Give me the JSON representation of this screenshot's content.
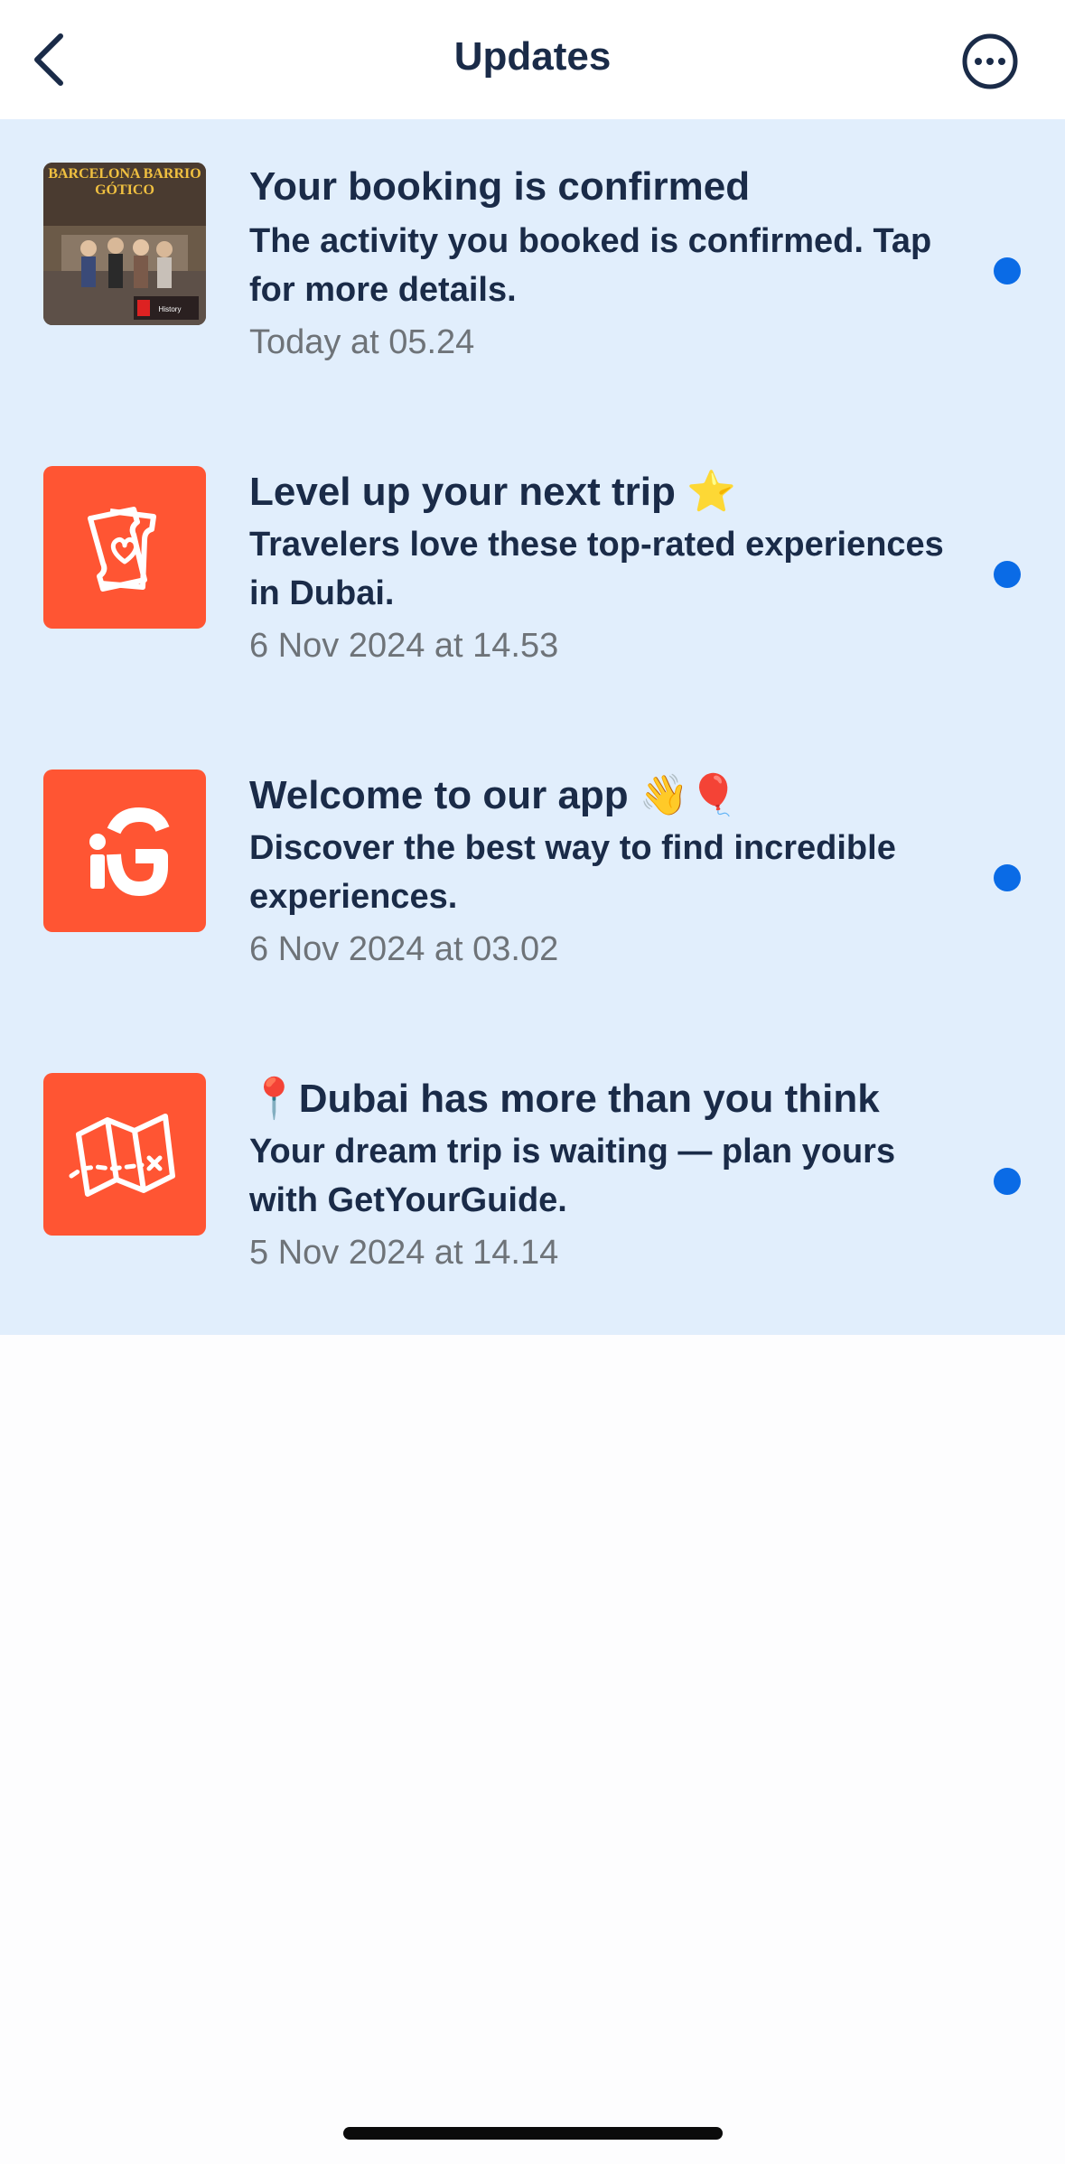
{
  "header": {
    "title": "Updates",
    "back_icon": "chevron-left-icon",
    "more_icon": "ellipsis-circle-icon"
  },
  "notifications": [
    {
      "title": "Your booking is confirmed",
      "body": "The activity you booked is confirmed. Tap for more details.",
      "time": "Today at 05.24",
      "thumbnail": "barcelona-tour-photo",
      "thumbnail_text": "BARCELONA BARRIO GÓTICO",
      "unread": true
    },
    {
      "title": "Level up your next trip ⭐",
      "body": "Travelers love these top-rated experiences in Dubai.",
      "time": "6 Nov 2024 at 14.53",
      "thumbnail": "ticket-heart-icon",
      "unread": true
    },
    {
      "title": "Welcome to our app 👋🎈",
      "body": "Discover the best way to find incredible experiences.",
      "time": "6 Nov 2024 at 03.02",
      "thumbnail": "getyourguide-logo-icon",
      "unread": true
    },
    {
      "title": "📍Dubai has more than you think",
      "body": "Your dream trip is waiting — plan yours with GetYourGuide.",
      "time": "5 Nov 2024 at 14.14",
      "thumbnail": "treasure-map-icon",
      "unread": true
    }
  ],
  "colors": {
    "accent_orange": "#ff5533",
    "unread_dot": "#0a6be6",
    "list_background": "#e1eefc",
    "text_primary": "#1a2b48",
    "text_secondary": "#6e7378"
  }
}
